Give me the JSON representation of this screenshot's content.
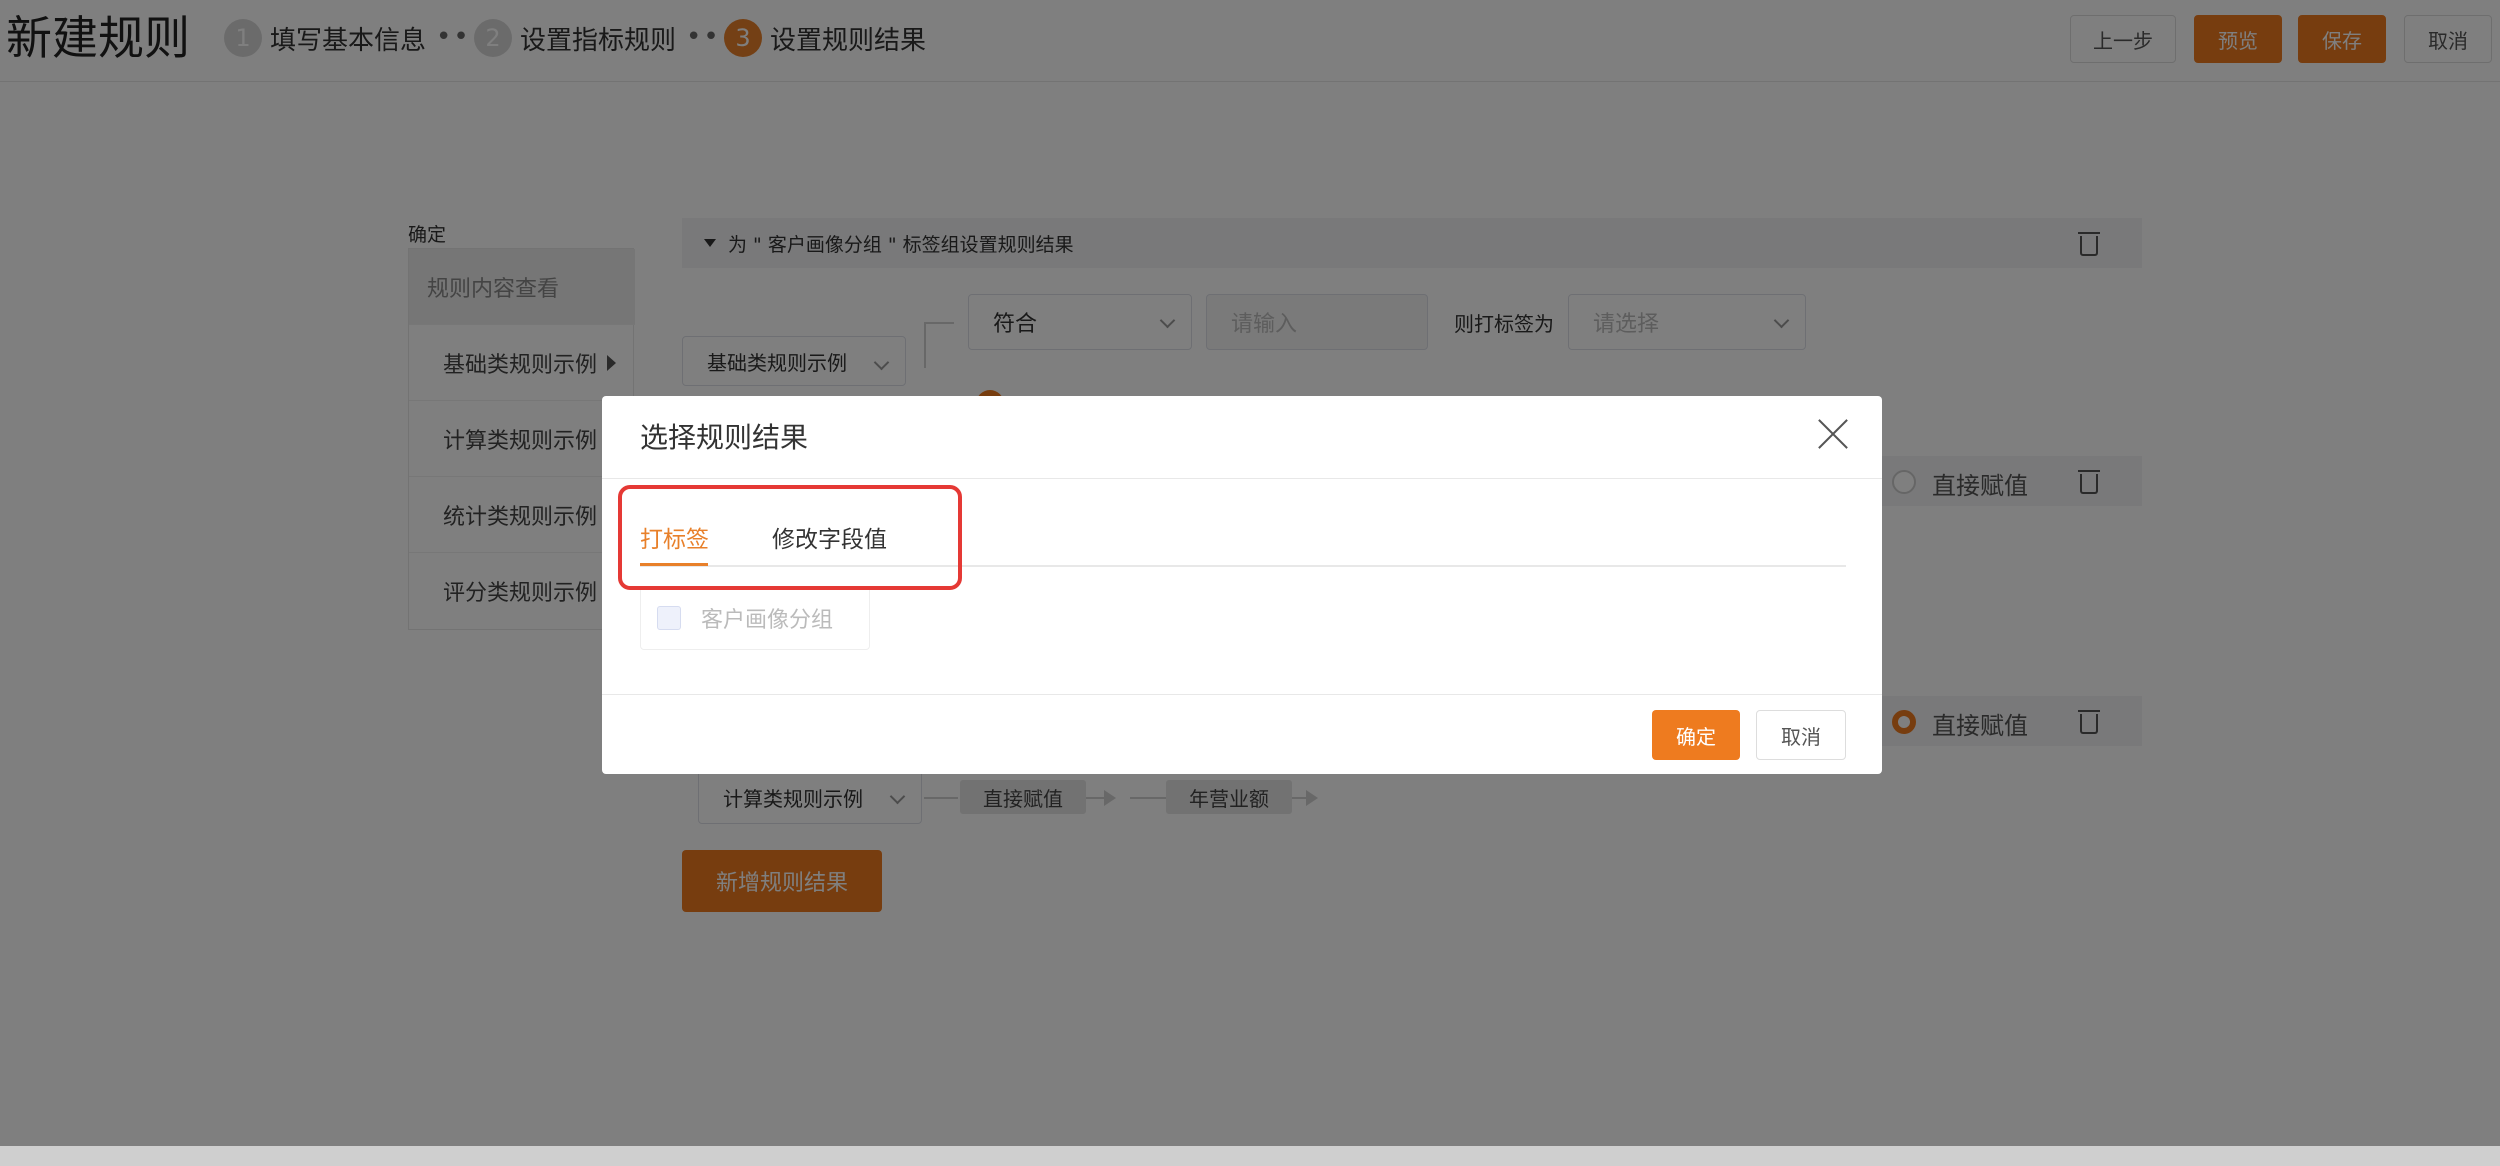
{
  "header": {
    "title": "新建规则",
    "steps": [
      {
        "num": "1",
        "label": "填写基本信息"
      },
      {
        "num": "2",
        "label": "设置指标规则"
      },
      {
        "num": "3",
        "label": "设置规则结果"
      }
    ],
    "dots": "•••",
    "buttons": {
      "prev": "上一步",
      "preview": "预览",
      "save": "保存",
      "cancel": "取消"
    }
  },
  "left_panel": {
    "confirm_label": "确定",
    "items": [
      "规则内容查看",
      "基础类规则示例",
      "计算类规则示例",
      "统计类规则示例",
      "评分类规则示例"
    ]
  },
  "content": {
    "group_bar": "为 \" 客户画像分组 \" 标签组设置规则结果",
    "rule1": {
      "select": "基础类规则示例",
      "condition": "符合",
      "input_placeholder": "请输入",
      "tag_label": "则打标签为",
      "tag_placeholder": "请选择"
    },
    "radio_label": "直接赋值",
    "rule2": {
      "select": "计算类规则示例",
      "chip1": "直接赋值",
      "chip2": "年营业额"
    },
    "add_button": "新增规则结果"
  },
  "modal": {
    "title": "选择规则结果",
    "tabs": [
      "打标签",
      "修改字段值"
    ],
    "checkbox_label": "客户画像分组",
    "confirm": "确定",
    "cancel": "取消"
  },
  "colors": {
    "accent": "#ee7b1f",
    "highlight": "#e53935"
  }
}
